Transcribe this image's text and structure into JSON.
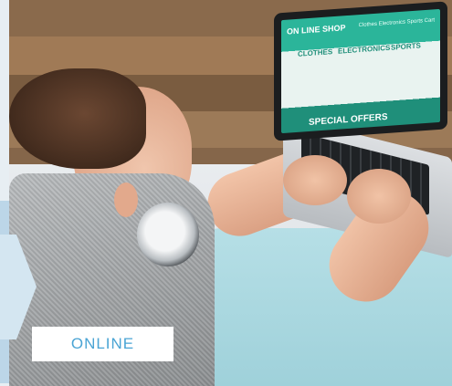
{
  "badge": {
    "label": "ONLINE"
  },
  "laptop_screen": {
    "shop_title": "ON LINE SHOP",
    "nav": "Clothes Electronics Sports Cart",
    "categories": [
      "CLOTHES",
      "ELECTRONICS",
      "SPORTS"
    ],
    "offer": "SPECIAL OFFERS"
  },
  "colors": {
    "badge_text": "#4aa4d4",
    "accent_blue": "#bcd6e8",
    "screen_green": "#2bb59a",
    "shirt": "#b6dfe6"
  }
}
